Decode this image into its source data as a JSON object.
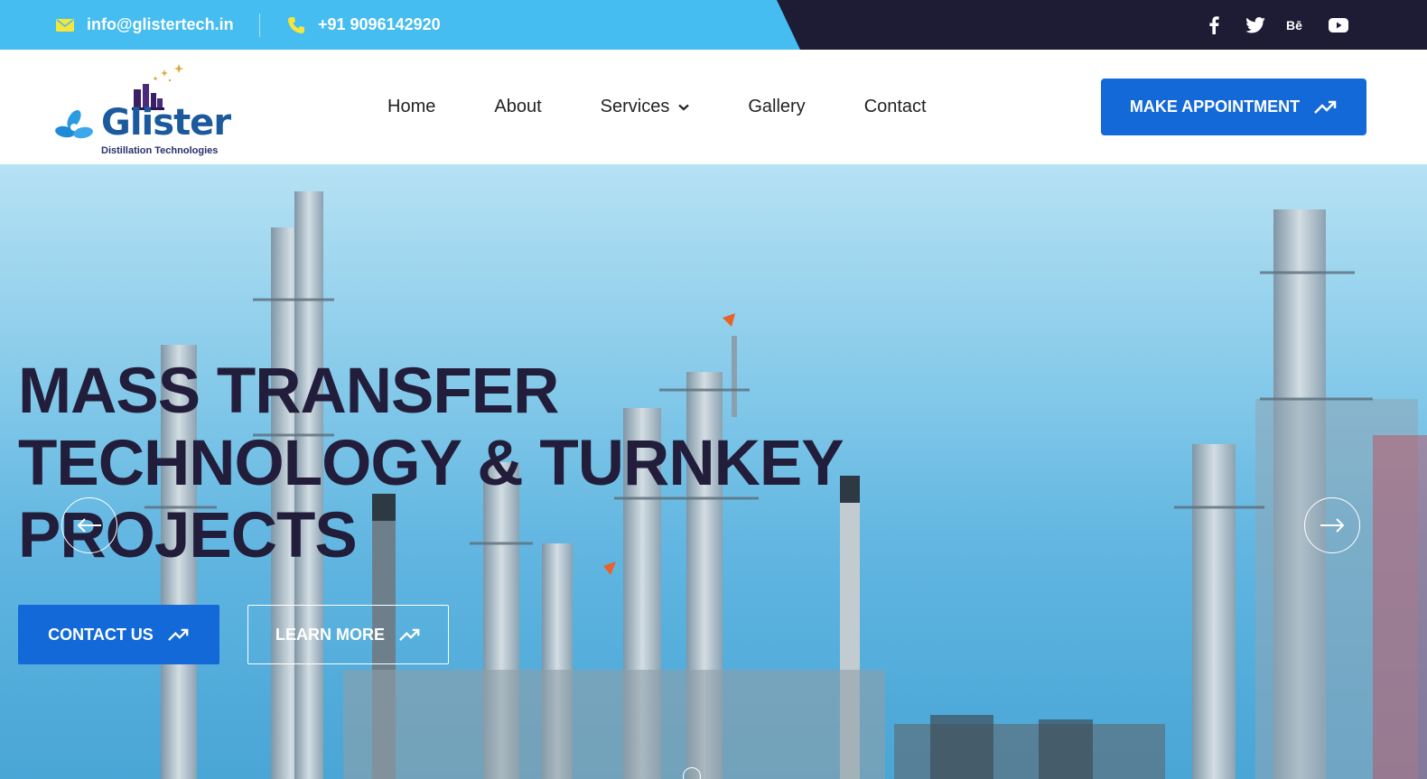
{
  "topbar": {
    "email": "info@glistertech.in",
    "phone": "+91 9096142920",
    "icons": {
      "email": "envelope-icon",
      "phone": "phone-icon"
    },
    "socials": [
      {
        "name": "facebook-icon",
        "glyph": "f"
      },
      {
        "name": "twitter-icon",
        "glyph": "t"
      },
      {
        "name": "behance-icon",
        "glyph": "Bē"
      },
      {
        "name": "youtube-icon",
        "glyph": "yt"
      }
    ],
    "colors": {
      "accent": "#45bdf0",
      "dark": "#1e1b35",
      "icon": "#f5e63c"
    }
  },
  "header": {
    "logo": {
      "word": "Glister",
      "subtitle": "Distillation Technologies"
    },
    "nav": [
      {
        "label": "Home"
      },
      {
        "label": "About"
      },
      {
        "label": "Services",
        "has_dropdown": true
      },
      {
        "label": "Gallery"
      },
      {
        "label": "Contact"
      }
    ],
    "cta_label": "MAKE APPOINTMENT",
    "cta_color": "#1469d8"
  },
  "hero": {
    "title_lines": [
      "MASS TRANSFER",
      "TECHNOLOGY & TURNKEY",
      "PROJECTS"
    ],
    "primary_button": "CONTACT US",
    "secondary_button": "LEARN MORE",
    "prev_icon": "arrow-left-icon",
    "next_icon": "arrow-right-icon",
    "trend_icon": "trending-up-icon",
    "title_color": "#221d3a"
  }
}
